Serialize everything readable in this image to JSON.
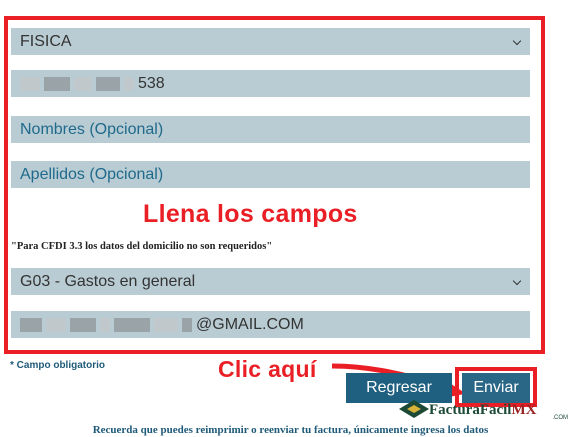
{
  "form": {
    "person_type": "FISICA",
    "rfc_suffix": "538",
    "names_placeholder": "Nombres (Opcional)",
    "surnames_placeholder": "Apellidos (Opcional)",
    "cfdi_note": "\"Para CFDI 3.3 los datos del domicilio no son requeridos\"",
    "cfdi_use": "G03 - Gastos en general",
    "email_suffix": "@GMAIL.COM",
    "required_note": "* Campo obligatorio"
  },
  "annotations": {
    "fill_fields": "Llena los campos",
    "click_here": "Clic aquí"
  },
  "buttons": {
    "back_label": "Regresar",
    "send_label": "Enviar"
  },
  "logo": {
    "brand_main": "FacturaFacil",
    "brand_mx": "MX",
    "brand_domain": ".COM"
  },
  "footer": {
    "text": "Recuerda que puedes reimprimir o reenviar tu factura, únicamente ingresa los datos"
  },
  "colors": {
    "annotation_red": "#ea1f25",
    "field_bg": "#b9ccd3",
    "button_bg": "#1f5f7f"
  }
}
